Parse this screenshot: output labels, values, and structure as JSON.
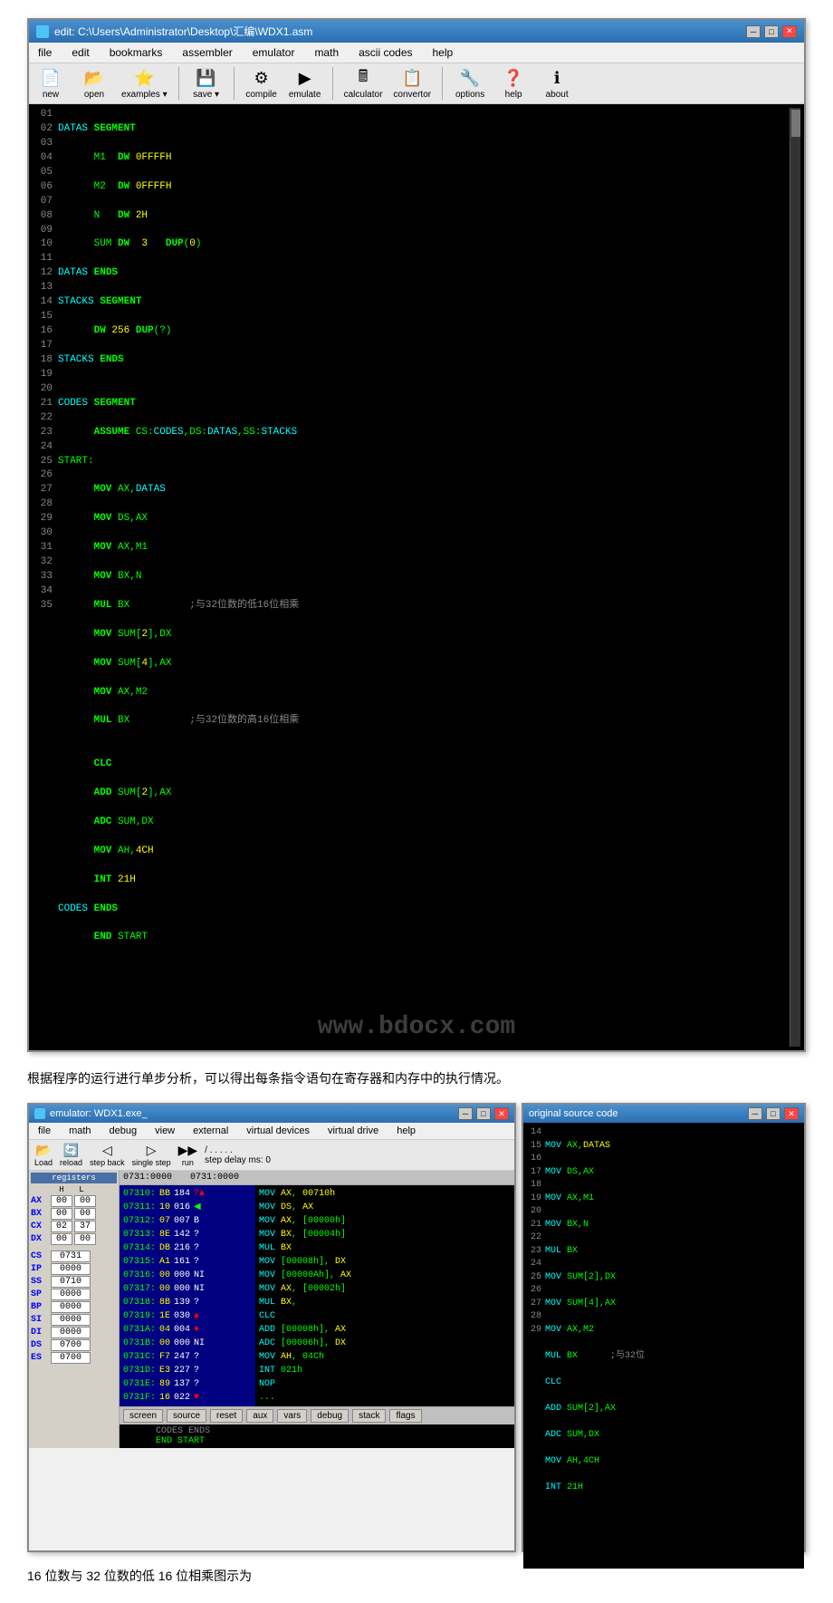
{
  "editor": {
    "title": "edit: C:\\Users\\Administrator\\Desktop\\汇编\\WDX1.asm",
    "menus": [
      "file",
      "edit",
      "bookmarks",
      "assembler",
      "emulator",
      "math",
      "ascii codes",
      "help"
    ],
    "toolbar": [
      {
        "label": "new",
        "icon": "📄"
      },
      {
        "label": "open",
        "icon": "📂"
      },
      {
        "label": "examples",
        "icon": "⭐"
      },
      {
        "label": "save",
        "icon": "💾"
      },
      {
        "label": "compile",
        "icon": "⚙"
      },
      {
        "label": "emulate",
        "icon": "▶"
      },
      {
        "label": "calculator",
        "icon": "🖩"
      },
      {
        "label": "convertor",
        "icon": "📋"
      },
      {
        "label": "options",
        "icon": "🔧"
      },
      {
        "label": "help",
        "icon": "❓"
      },
      {
        "label": "about",
        "icon": "ℹ"
      }
    ],
    "code_lines": [
      {
        "num": "01",
        "text": "DATAS SEGMENT"
      },
      {
        "num": "02",
        "text": "      M1  DW 0FFFFH"
      },
      {
        "num": "03",
        "text": "      M2  DW 0FFFFH"
      },
      {
        "num": "04",
        "text": "      N   DW 2H"
      },
      {
        "num": "05",
        "text": "      SUM DW  3   DUP(0)"
      },
      {
        "num": "06",
        "text": "DATAS ENDS"
      },
      {
        "num": "07",
        "text": "STACKS SEGMENT"
      },
      {
        "num": "08",
        "text": "      DW 256 DUP(?)"
      },
      {
        "num": "09",
        "text": "STACKS ENDS"
      },
      {
        "num": "10",
        "text": ""
      },
      {
        "num": "11",
        "text": "CODES SEGMENT"
      },
      {
        "num": "12",
        "text": "      ASSUME CS:CODES,DS:DATAS,SS:STACKS"
      },
      {
        "num": "13",
        "text": "START:"
      },
      {
        "num": "14",
        "text": "      MOV AX,DATAS"
      },
      {
        "num": "15",
        "text": "      MOV DS,AX"
      },
      {
        "num": "16",
        "text": "      MOV AX,M1"
      },
      {
        "num": "17",
        "text": "      MOV BX,N"
      },
      {
        "num": "18",
        "text": "      MUL BX          ;与32位数的低16位相乘"
      },
      {
        "num": "19",
        "text": "      MOV SUM[2],DX"
      },
      {
        "num": "20",
        "text": "      MOV SUM[4],AX"
      },
      {
        "num": "21",
        "text": "      MOV AX,M2"
      },
      {
        "num": "22",
        "text": "      MUL BX          ;与32位数的高16位相乘"
      },
      {
        "num": "23",
        "text": ""
      },
      {
        "num": "24",
        "text": "      CLC"
      },
      {
        "num": "25",
        "text": "      ADD SUM[2],AX"
      },
      {
        "num": "26",
        "text": "      ADC SUM,DX"
      },
      {
        "num": "27",
        "text": "      MOV AH,4CH"
      },
      {
        "num": "28",
        "text": "      INT 21H"
      },
      {
        "num": "29",
        "text": "CODES ENDS"
      },
      {
        "num": "30",
        "text": "      END START"
      },
      {
        "num": "31",
        "text": ""
      },
      {
        "num": "32",
        "text": ""
      },
      {
        "num": "33",
        "text": ""
      },
      {
        "num": "34",
        "text": ""
      },
      {
        "num": "35",
        "text": ""
      }
    ]
  },
  "paragraph1": "根据程序的运行进行单步分析，可以得出每条指令语句在寄存器和内存中的执行情况。",
  "emulator": {
    "title": "emulator: WDX1.exe_",
    "menus": [
      "file",
      "math",
      "debug",
      "view",
      "external",
      "virtual devices",
      "virtual drive",
      "help"
    ],
    "toolbar": [
      {
        "label": "Load",
        "icon": "📂"
      },
      {
        "label": "reload",
        "icon": "🔄"
      },
      {
        "label": "step back",
        "icon": "◁"
      },
      {
        "label": "single step",
        "icon": "▷"
      },
      {
        "label": "run",
        "icon": "▶▶"
      },
      {
        "label": "step delay ms: 0",
        "icon": ""
      }
    ],
    "registers": {
      "header": "registers",
      "items": [
        {
          "name": "AX",
          "h": "00",
          "l": "00"
        },
        {
          "name": "BX",
          "h": "00",
          "l": "00"
        },
        {
          "name": "CX",
          "h": "02",
          "l": "37"
        },
        {
          "name": "DX",
          "h": "00",
          "l": "00"
        },
        {
          "name": "CS",
          "val": "0731"
        },
        {
          "name": "IP",
          "val": "0000"
        },
        {
          "name": "SS",
          "val": "0710"
        },
        {
          "name": "SP",
          "val": "0000"
        },
        {
          "name": "BP",
          "val": "0000"
        },
        {
          "name": "SI",
          "val": "0000"
        },
        {
          "name": "DI",
          "val": "0000"
        },
        {
          "name": "DS",
          "val": "0700"
        },
        {
          "name": "ES",
          "val": "0700"
        }
      ]
    },
    "addr_bar": {
      "left": "0731:0000",
      "right": "0731:0000"
    },
    "hex_lines": [
      {
        "addr": "07310:",
        "b1": "BB",
        "b2": "184",
        "mark": "?▲",
        "asm": "MOV  AX, 00710h"
      },
      {
        "addr": "07311:",
        "b1": "10",
        "b2": "016",
        "mark": "◀",
        "asm": "MOV  DS, AX"
      },
      {
        "addr": "07312:",
        "b1": "07",
        "b2": "007",
        "mark": "B",
        "asm": "MOV  AX, [00000h]"
      },
      {
        "addr": "07313:",
        "b1": "8E",
        "b2": "142",
        "mark": "?",
        "asm": "MOV  BX, [00004h]"
      },
      {
        "addr": "07314:",
        "b1": "DB",
        "b2": "216",
        "mark": "?",
        "asm": "MUL  BX"
      },
      {
        "addr": "07315:",
        "b1": "A1",
        "b2": "161",
        "mark": "?",
        "asm": "MOV  [00008h], DX"
      },
      {
        "addr": "07316:",
        "b1": "00",
        "b2": "000",
        "mark": "NI",
        "asm": "MOV  [00000Ah], AX"
      },
      {
        "addr": "07317:",
        "b1": "00",
        "b2": "000",
        "mark": "NI",
        "asm": "MOV  AX, [00002h]"
      },
      {
        "addr": "07318:",
        "b1": "8B",
        "b2": "139",
        "mark": "?",
        "asm": "MUL  BX,"
      },
      {
        "addr": "07319:",
        "b1": "1E",
        "b2": "030",
        "mark": "▲",
        "asm": "CLC"
      },
      {
        "addr": "0731A:",
        "b1": "04",
        "b2": "004",
        "mark": "♦",
        "asm": "ADD  [00008h], AX"
      },
      {
        "addr": "0731B:",
        "b1": "00",
        "b2": "000",
        "mark": "NI",
        "asm": "ADC  [00006h], DX"
      },
      {
        "addr": "0731C:",
        "b1": "F7",
        "b2": "247",
        "mark": "?",
        "asm": "MOV  AH, 04Ch"
      },
      {
        "addr": "0731D:",
        "b1": "E3",
        "b2": "227",
        "mark": "?",
        "asm": "INT  021h"
      },
      {
        "addr": "0731E:",
        "b1": "89",
        "b2": "137",
        "mark": "?",
        "asm": "NOP"
      },
      {
        "addr": "0731F:",
        "b1": "16",
        "b2": "022",
        "mark": "▼",
        "asm": "..."
      }
    ],
    "bottom_tabs": [
      "screen",
      "source",
      "reset",
      "aux",
      "vars",
      "debug",
      "stack",
      "flags"
    ],
    "extra_code": [
      "      CODES ENDS",
      "      END START"
    ]
  },
  "source_window": {
    "title": "original source code",
    "line_nums": [
      "14",
      "15",
      "16",
      "17",
      "18",
      "19",
      "20",
      "21",
      "22",
      "23",
      "24",
      "25",
      "26",
      "27",
      "28",
      "29"
    ],
    "lines": [
      "MOV AX,DATAS",
      "MOV DS,AX",
      "MOV AX,M1",
      "MOV BX,N",
      "MUL BX",
      "MOV SUM[2],DX",
      "MOV SUM[4],AX",
      "MOV AX,M2",
      "MUL BX      ;与32位",
      "CLC",
      "ADD SUM[2],AX",
      "ADC SUM,DX",
      "MOV AH,4CH",
      "INT 21H",
      "",
      ""
    ]
  },
  "paragraph2": "16 位数与 32 位数的低 16 位相乘图示为",
  "watermark": "www.bdocx.com"
}
